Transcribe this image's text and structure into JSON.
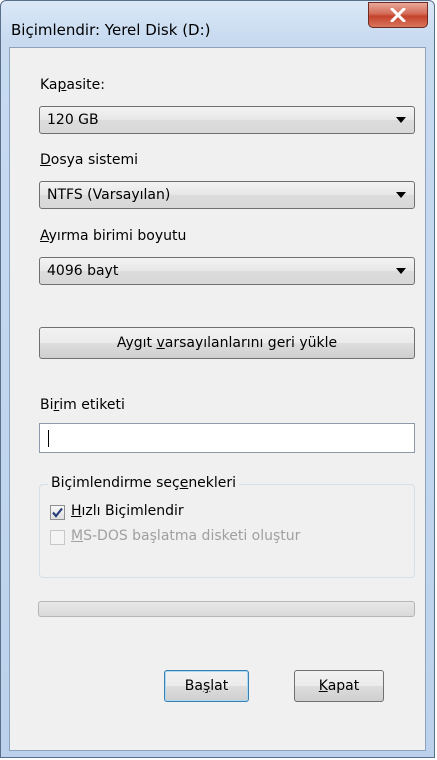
{
  "window": {
    "title": "Biçimlendir: Yerel Disk (D:)"
  },
  "capacity": {
    "label_pre": "Ka",
    "label_mn": "p",
    "label_post": "asite:",
    "value": "120 GB"
  },
  "filesystem": {
    "label_pre": "",
    "label_mn": "D",
    "label_post": "osya sistemi",
    "value": "NTFS (Varsayılan)"
  },
  "allocation": {
    "label_pre": "",
    "label_mn": "A",
    "label_post": "yırma birimi boyutu",
    "value": "4096 bayt"
  },
  "restore_button": {
    "label_pre": "Aygıt ",
    "label_mn": "v",
    "label_post": "arsayılanlarını geri yükle"
  },
  "volume_label": {
    "label_pre": "Bi",
    "label_mn": "r",
    "label_post": "im etiketi",
    "value": ""
  },
  "format_options": {
    "title_pre": "Biçimlendirme seç",
    "title_mn": "e",
    "title_post": "nekleri",
    "quick_format": {
      "label_pre": "",
      "label_mn": "H",
      "label_post": "ızlı Biçimlendir",
      "checked": true
    },
    "msdos_disk": {
      "label_pre": "",
      "label_mn": "M",
      "label_post": "S-DOS başlatma disketi oluştur",
      "checked": false,
      "enabled": false
    }
  },
  "progress": {
    "value": 0
  },
  "buttons": {
    "start": {
      "label_pre": "Ba",
      "label_mn": "ş",
      "label_post": "lat"
    },
    "close": {
      "label_pre": "",
      "label_mn": "K",
      "label_post": "apat"
    }
  },
  "colors": {
    "title_accent": "#c5432c",
    "progress_fill": "#3cb43c"
  }
}
